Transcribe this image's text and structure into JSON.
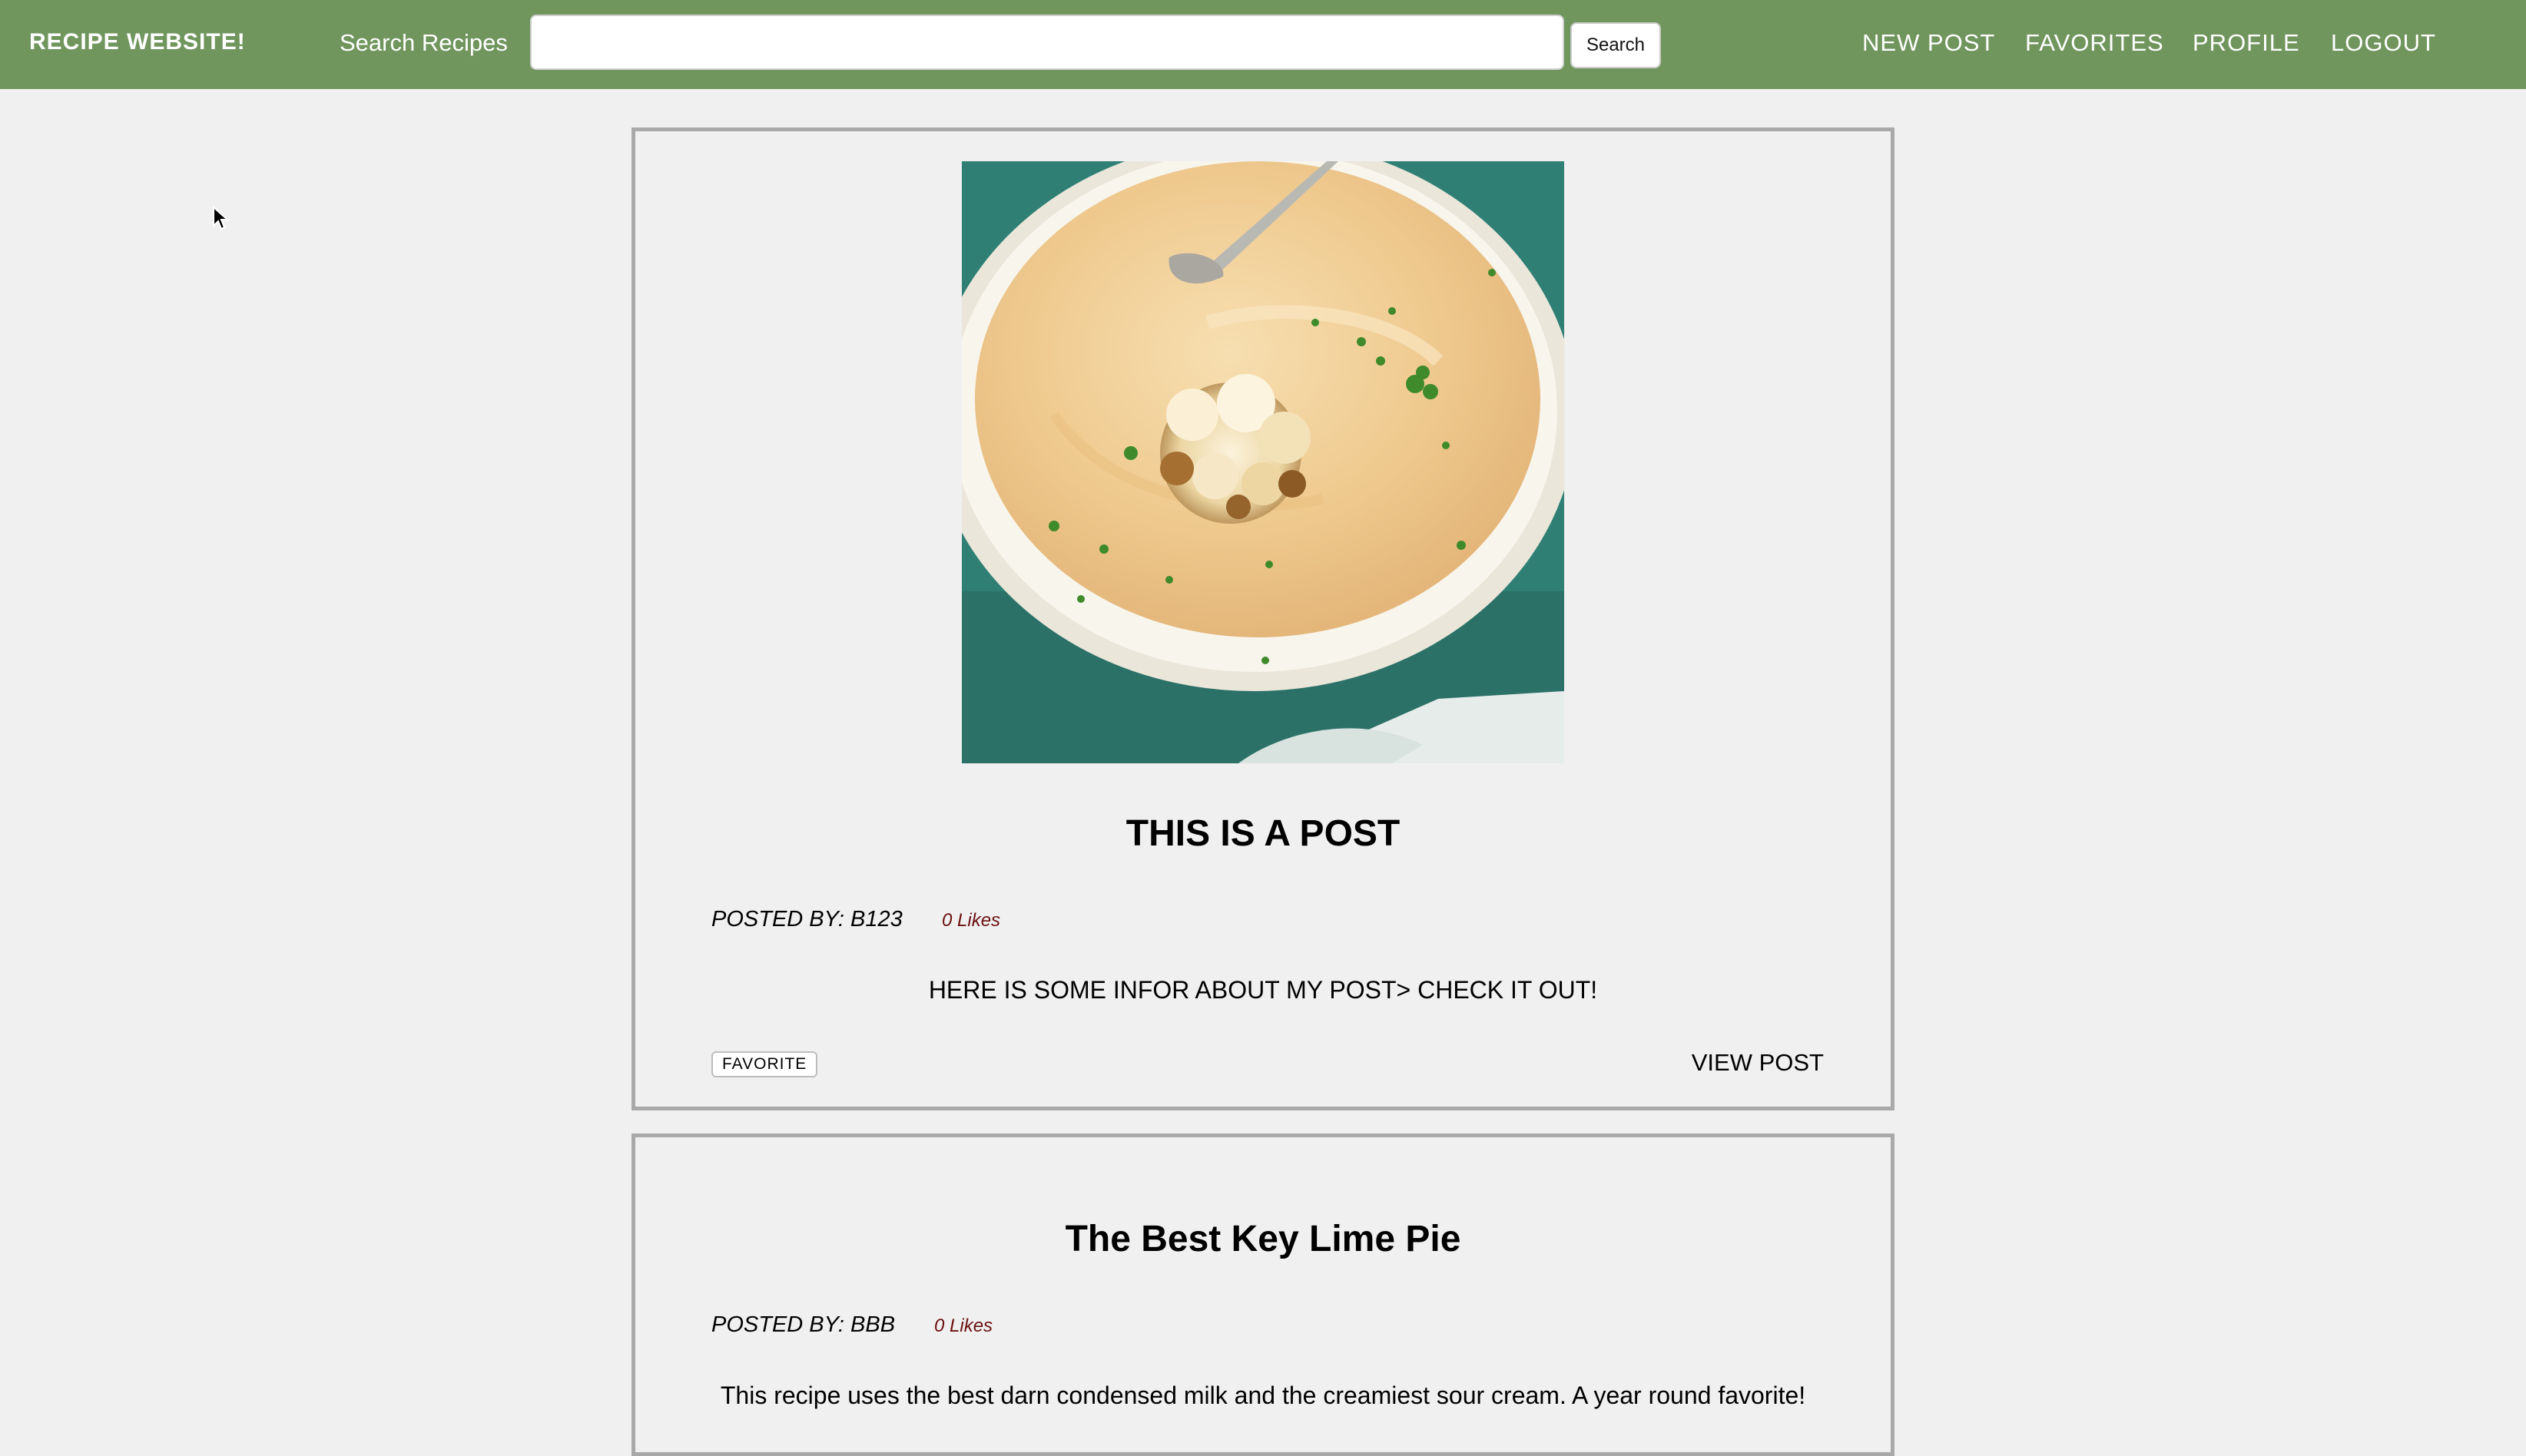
{
  "navbar": {
    "brand": "RECIPE WEBSITE!",
    "search_label": "Search Recipes",
    "search_value": "",
    "search_placeholder": "",
    "search_button": "Search",
    "links": [
      "NEW POST",
      "FAVORITES",
      "PROFILE",
      "LOGOUT"
    ],
    "bg_color": "#70965e"
  },
  "posts": [
    {
      "title": "THIS IS A POST",
      "posted_by": "POSTED BY: B123",
      "likes": "0 Likes",
      "description": "HERE IS SOME INFOR ABOUT MY POST> CHECK IT OUT!",
      "favorite_label": "FAVORITE",
      "view_label": "VIEW POST",
      "image": "cauliflower soup in a bowl"
    },
    {
      "title": "The Best Key Lime Pie",
      "posted_by": "POSTED BY: BBB",
      "likes": "0 Likes",
      "description": "This recipe uses the best darn condensed milk and the creamiest sour cream. A year round favorite!"
    }
  ],
  "colors": {
    "page_bg": "#f0f0f0",
    "card_border": "#a9a9a9",
    "likes": "#6b0f0f"
  }
}
